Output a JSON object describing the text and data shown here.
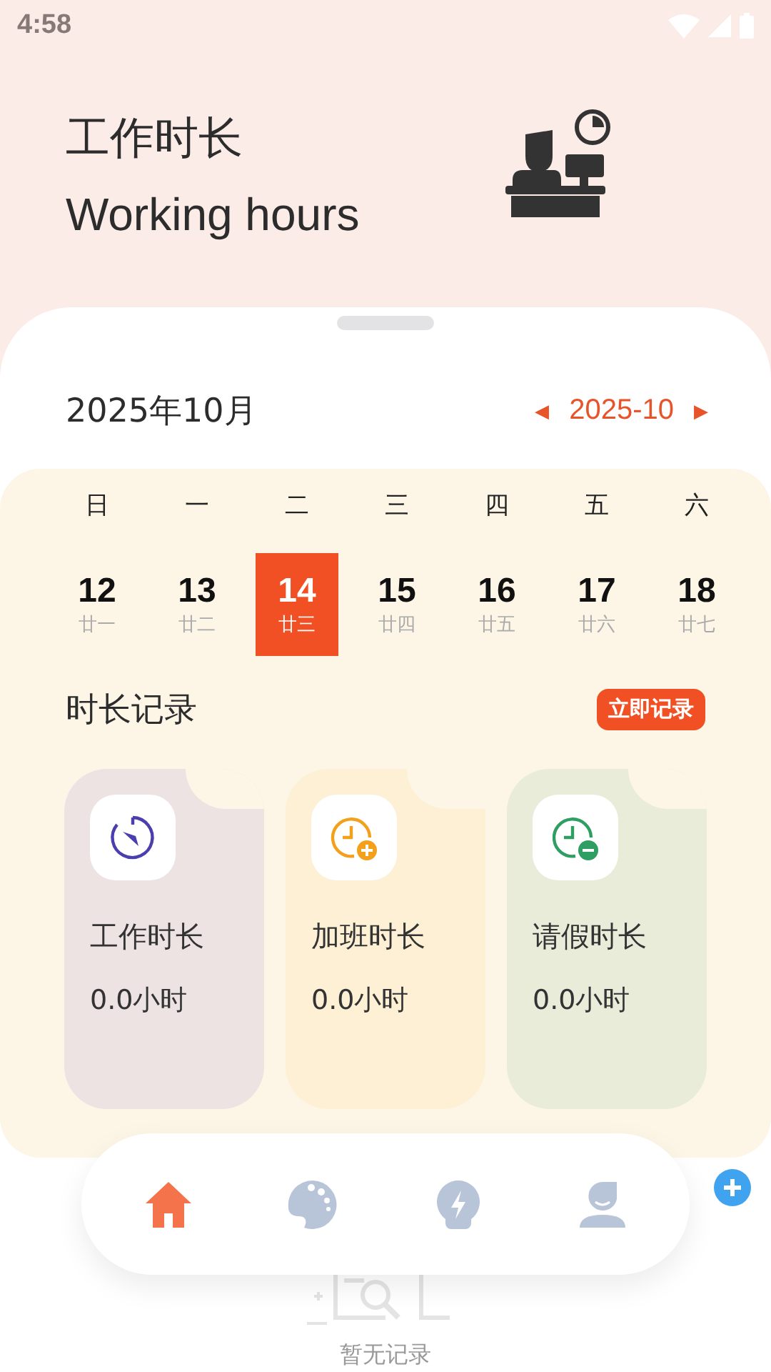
{
  "status_bar": {
    "time": "4:58"
  },
  "header": {
    "title": "工作时长",
    "subtitle": "Working hours"
  },
  "month_bar": {
    "month_label": "2025年10月",
    "prev": "◀",
    "current": "2025-10",
    "next": "▶"
  },
  "calendar": {
    "weekdays": [
      "日",
      "一",
      "二",
      "三",
      "四",
      "五",
      "六"
    ],
    "days": [
      {
        "date": "12",
        "lunar": "廿一",
        "selected": false
      },
      {
        "date": "13",
        "lunar": "廿二",
        "selected": false
      },
      {
        "date": "14",
        "lunar": "廿三",
        "selected": true
      },
      {
        "date": "15",
        "lunar": "廿四",
        "selected": false
      },
      {
        "date": "16",
        "lunar": "廿五",
        "selected": false
      },
      {
        "date": "17",
        "lunar": "廿六",
        "selected": false
      },
      {
        "date": "18",
        "lunar": "廿七",
        "selected": false
      }
    ]
  },
  "records": {
    "title": "时长记录",
    "action": "立即记录",
    "cards": [
      {
        "kind": "work",
        "label": "工作时长",
        "value": "0.0小时"
      },
      {
        "kind": "overtime",
        "label": "加班时长",
        "value": "0.0小时"
      },
      {
        "kind": "leave",
        "label": "请假时长",
        "value": "0.0小时"
      }
    ]
  },
  "notes": {
    "empty_text": "暂无记录"
  },
  "nav": [
    {
      "kind": "home",
      "selected": true
    },
    {
      "kind": "palette",
      "selected": false
    },
    {
      "kind": "idea",
      "selected": false
    },
    {
      "kind": "profile",
      "selected": false
    }
  ]
}
